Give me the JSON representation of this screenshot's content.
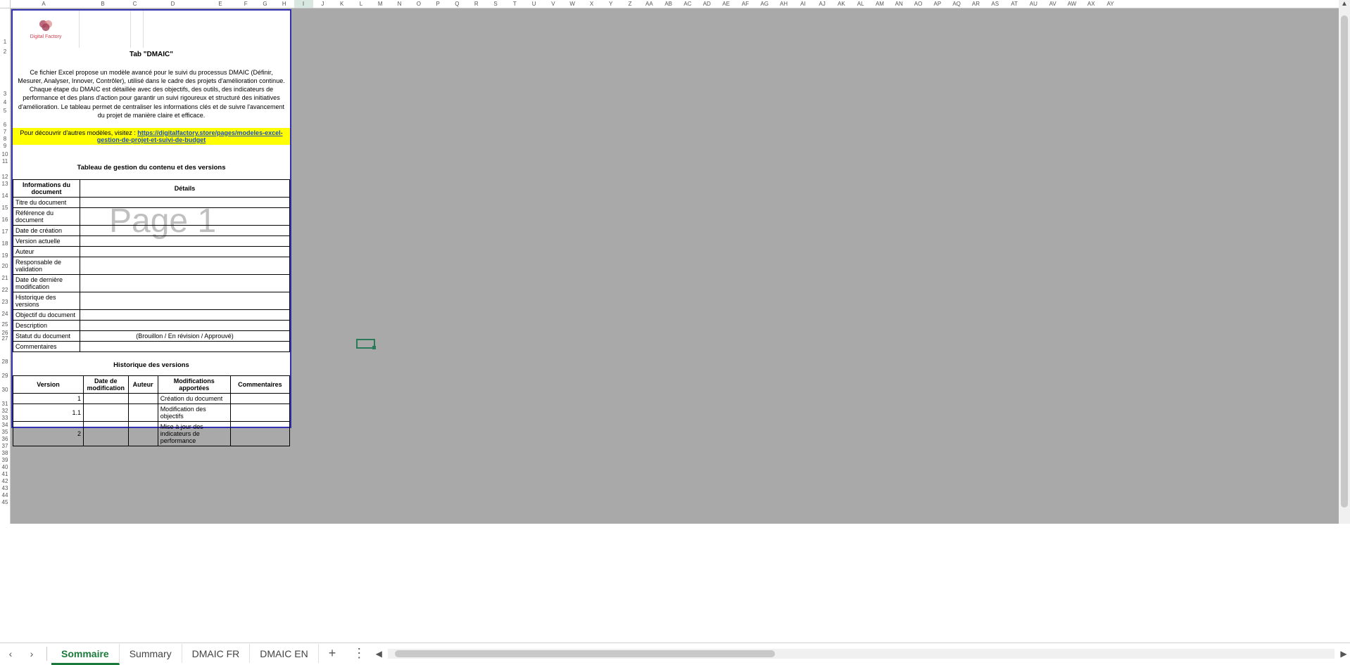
{
  "columns": [
    "A",
    "B",
    "C",
    "D",
    "E",
    "F",
    "G",
    "H",
    "I",
    "J",
    "K",
    "L",
    "M",
    "N",
    "O",
    "P",
    "Q",
    "R",
    "S",
    "T",
    "U",
    "V",
    "W",
    "X",
    "Y",
    "Z",
    "AA",
    "AB",
    "AC",
    "AD",
    "AE",
    "AF",
    "AG",
    "AH",
    "AI",
    "AJ",
    "AK",
    "AL",
    "AM",
    "AN",
    "AO",
    "AP",
    "AQ",
    "AR",
    "AS",
    "AT",
    "AU",
    "AV",
    "AW",
    "AX",
    "AY"
  ],
  "row_heights": {
    "1": 53,
    "2": 14,
    "3": 60,
    "4": 12,
    "5": 12,
    "6": 20,
    "7": 10,
    "8": 10,
    "9": 10,
    "10": 12,
    "11": 10,
    "12": 22,
    "13": 10,
    "14": 17,
    "15": 17,
    "16": 17,
    "17": 17,
    "18": 17,
    "19": 17,
    "20": 15,
    "21": 17,
    "22": 17,
    "23": 17,
    "24": 17,
    "25": 15,
    "26": 12,
    "27": 8,
    "28": 33,
    "29": 20,
    "30": 20,
    "31": 20,
    "32": 10,
    "33": 10,
    "34": 10,
    "35": 10,
    "36": 10,
    "37": 10,
    "38": 10,
    "39": 10,
    "40": 10,
    "41": 10,
    "42": 10,
    "43": 10,
    "44": 10,
    "45": 10
  },
  "watermark": "Page 1",
  "logo_text": "Digital Factory",
  "title": "Tab \"DMAIC\"",
  "description": "Ce fichier Excel propose un modèle avancé pour le suivi du processus DMAIC (Définir, Mesurer, Analyser, Innover, Contrôler), utilisé dans le cadre des projets d'amélioration continue. Chaque étape du DMAIC est détaillée avec des objectifs, des outils, des indicateurs de performance et des plans d'action pour garantir un suivi rigoureux et structuré des initiatives d'amélioration. Le tableau permet de centraliser les informations clés et de suivre l'avancement du projet de manière claire et efficace.",
  "yellow_prefix": "Pour découvrir d'autres modèles, visitez : ",
  "yellow_link1": "https://digitalfactory.store/pages/modeles-excel-",
  "yellow_link2": "gestion-de-projet-et-suivi-de-budget",
  "section_version": "Tableau de gestion du contenu et des versions",
  "info_table": {
    "header1": "Informations du document",
    "header2": "Détails",
    "rows": [
      {
        "label": "Titre du document",
        "value": ""
      },
      {
        "label": "Référence du document",
        "value": ""
      },
      {
        "label": "Date de création",
        "value": ""
      },
      {
        "label": "Version actuelle",
        "value": ""
      },
      {
        "label": "Auteur",
        "value": ""
      },
      {
        "label": "Responsable de validation",
        "value": ""
      },
      {
        "label": "Date de dernière modification",
        "value": ""
      },
      {
        "label": "Historique des versions",
        "value": ""
      },
      {
        "label": "Objectif du document",
        "value": ""
      },
      {
        "label": "Description",
        "value": ""
      },
      {
        "label": "Statut du document",
        "value": "(Brouillon / En révision / Approuvé)"
      },
      {
        "label": "Commentaires",
        "value": ""
      }
    ]
  },
  "history_title": "Historique des versions",
  "history": {
    "headers": [
      "Version",
      "Date de modification",
      "Auteur",
      "Modifications apportées",
      "Commentaires"
    ],
    "rows": [
      {
        "v": "1",
        "d": "",
        "a": "",
        "m": "Création du document",
        "c": ""
      },
      {
        "v": "1.1",
        "d": "",
        "a": "",
        "m": "Modification des objectifs",
        "c": ""
      },
      {
        "v": "2",
        "d": "",
        "a": "",
        "m": "Mise à jour des indicateurs de performance",
        "c": ""
      }
    ]
  },
  "tabs": [
    "Sommaire",
    "Summary",
    "DMAIC FR",
    "DMAIC EN"
  ],
  "add_label": "+",
  "nav_prev": "‹",
  "nav_next": "›",
  "dots": "⋮",
  "hleft": "◀",
  "hright": "▶",
  "vup": "▲",
  "vdown": "▼"
}
